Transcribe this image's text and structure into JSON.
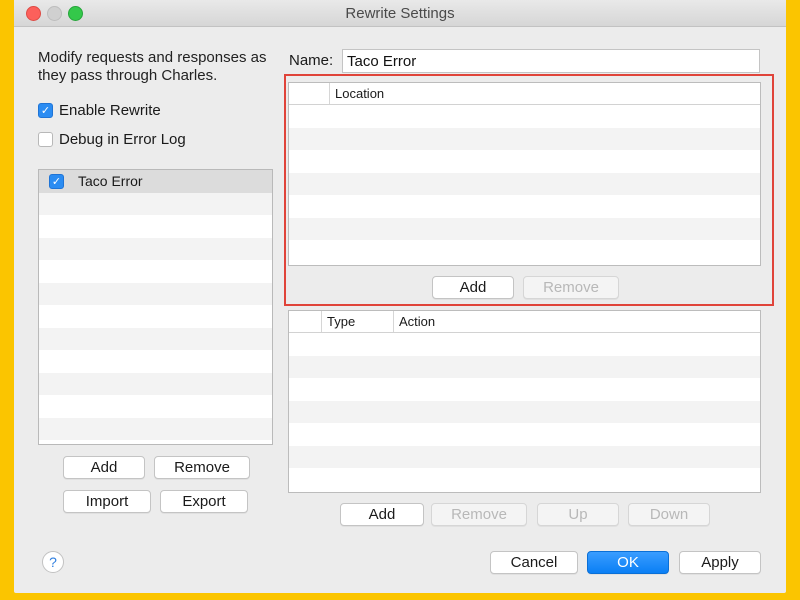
{
  "window": {
    "title": "Rewrite Settings"
  },
  "intro": {
    "text": "Modify requests and responses as they pass through Charles."
  },
  "options": {
    "enable_rewrite": {
      "label": "Enable Rewrite",
      "checked": true
    },
    "debug_log": {
      "label": "Debug in Error Log",
      "checked": false
    }
  },
  "rules": {
    "items": [
      {
        "label": "Taco Error",
        "checked": true
      }
    ],
    "buttons": {
      "add": "Add",
      "remove": "Remove",
      "import": "Import",
      "export": "Export"
    }
  },
  "detail": {
    "name_label": "Name:",
    "name_value": "Taco Error",
    "location_table": {
      "headers": [
        "Location"
      ],
      "rows": []
    },
    "location_buttons": {
      "add": "Add",
      "remove": "Remove"
    },
    "rules_table": {
      "headers": [
        "Type",
        "Action"
      ],
      "rows": []
    },
    "rules_buttons": {
      "add": "Add",
      "remove": "Remove",
      "up": "Up",
      "down": "Down"
    }
  },
  "footer": {
    "help": "?",
    "cancel": "Cancel",
    "ok": "OK",
    "apply": "Apply"
  },
  "colors": {
    "accent": "#2b8cf2",
    "highlight_border": "#e0443a",
    "background": "#fbc500"
  }
}
